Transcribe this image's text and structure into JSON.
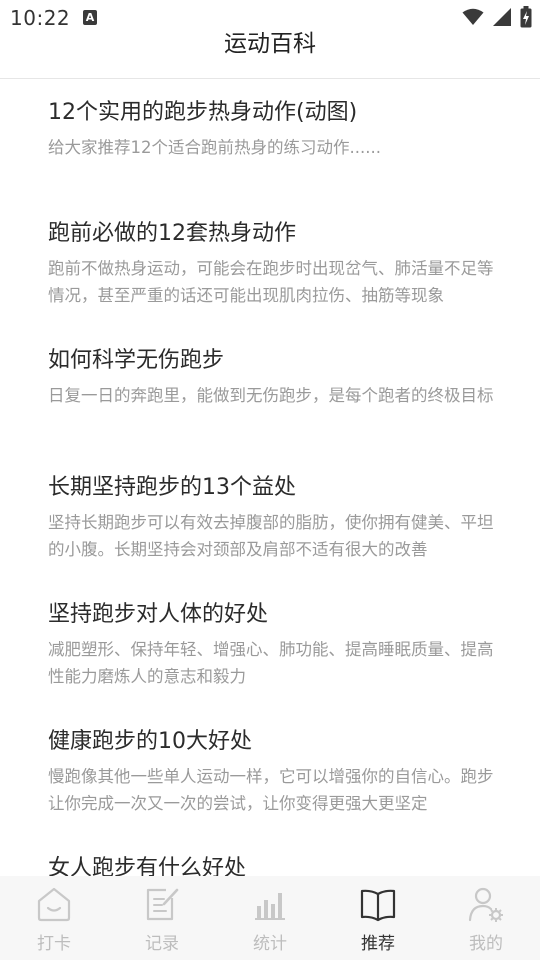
{
  "status_bar": {
    "time": "10:22",
    "a_icon_text": "A"
  },
  "header": {
    "title": "运动百科"
  },
  "articles": [
    {
      "title": "12个实用的跑步热身动作(动图)",
      "summary": "给大家推荐12个适合跑前热身的练习动作......"
    },
    {
      "title": "跑前必做的12套热身动作",
      "summary": "跑前不做热身运动，可能会在跑步时出现岔气、肺活量不足等情况，甚至严重的话还可能出现肌肉拉伤、抽筋等现象"
    },
    {
      "title": "如何科学无伤跑步",
      "summary": "日复一日的奔跑里，能做到无伤跑步，是每个跑者的终极目标"
    },
    {
      "title": "长期坚持跑步的13个益处",
      "summary": "坚持长期跑步可以有效去掉腹部的脂肪，使你拥有健美、平坦的小腹。长期坚持会对颈部及肩部不适有很大的改善"
    },
    {
      "title": "坚持跑步对人体的好处",
      "summary": "减肥塑形、保持年轻、增强心、肺功能、提高睡眠质量、提高性能力磨炼人的意志和毅力"
    },
    {
      "title": "健康跑步的10大好处",
      "summary": "慢跑像其他一些单人运动一样，它可以增强你的自信心。跑步让你完成一次又一次的尝试，让你变得更强大更坚定"
    },
    {
      "title": "女人跑步有什么好处",
      "summary": ""
    }
  ],
  "bottom_nav": {
    "active_index": 3,
    "active_color": "#333333",
    "inactive_color": "#bdbdbd",
    "items": [
      {
        "label": "打卡",
        "icon": "house-icon"
      },
      {
        "label": "记录",
        "icon": "note-edit-icon"
      },
      {
        "label": "统计",
        "icon": "bar-chart-icon"
      },
      {
        "label": "推荐",
        "icon": "open-book-icon"
      },
      {
        "label": "我的",
        "icon": "user-settings-icon"
      }
    ]
  }
}
